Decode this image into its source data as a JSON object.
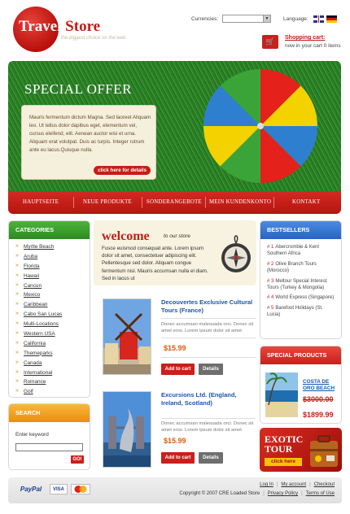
{
  "header": {
    "logo_word1": "Travel",
    "logo_word2": "Store",
    "tagline": "the biggest choice on the web",
    "currencies_label": "Currencies:",
    "language_label": "Language:",
    "cart_link": "Shopping cart:",
    "cart_items": "now in your cart 0 items"
  },
  "hero": {
    "title": "SPECIAL OFFER",
    "text": "Mauris fermentum dictum Magna. Sed laoreet Aliquam leo. Ut tellus dolor dapibus eget, elementum vel, cursus eleifend, elit. Aenean auctor wisi et urna. Aliquam erat volutpat. Duis ac turpis. Integer rutrum ante eu lacus.Quisque nulla.",
    "button": "click here for details"
  },
  "nav": [
    "HAUPTSEITE",
    "NEUE PRODUKTE",
    "SONDERANGEBOTE",
    "MEIN KUNDENKONTO",
    "KONTAKT"
  ],
  "categories": {
    "title": "CATEGORIES",
    "items": [
      "Myrtle Beach",
      "Aruba",
      "Florida",
      "Hawaii",
      "Cancun",
      "Mexico",
      "Caribbean",
      "Cabo San Lucas",
      "Multi-Locations",
      "Western USA",
      "California",
      "Themeparks",
      "Canada",
      "International",
      "Romance",
      "Golf"
    ]
  },
  "search": {
    "title": "SEARCH",
    "label": "Enter keyword",
    "go": "GO!"
  },
  "welcome": {
    "title": "welcome",
    "subtitle": "to our store",
    "text": "Fusce euismod consequat ante. Lorem ipsum dolor sit amet, consectetuer adipiscing elit. Pellentesque sed dolor. Aliquam congue fermentum nisl. Mauris accumsan nulla el diam. Sed in lacus ut"
  },
  "products": [
    {
      "title": "Decouvertes Exclusive Cultural Tours (France)",
      "desc": "Donec accumsan malesuada orci. Donec sit amet eros. Lorem ipsum dolor sit amet",
      "price": "$15.99",
      "add": "Add to cart",
      "details": "Details"
    },
    {
      "title": "Excursions Ltd. (England, Ireland, Scotland)",
      "desc": "Donec accumsan malesuada orci. Donec sit amet eros. Lorem ipsum dolor sit amet",
      "price": "$15.99",
      "add": "Add to cart",
      "details": "Details"
    }
  ],
  "bestsellers": {
    "title": "BESTSELLERS",
    "items": [
      {
        "num": "# 1",
        "text": "Abercrombie & Kent Southern Africa"
      },
      {
        "num": "# 2",
        "text": "Olive Branch Tours (Morocco)"
      },
      {
        "num": "# 3",
        "text": "Meltour Special Interest Tours (Turkey & Mongolia)"
      },
      {
        "num": "# 4",
        "text": "World Express (Singapore)"
      },
      {
        "num": "# 5",
        "text": "Barefoot Holidays (St. Lucia)"
      }
    ]
  },
  "specials": {
    "title": "SPECIAL PRODUCTS",
    "name": "COSTA DE ORO BEACH",
    "old_price": "$3000.00",
    "new_price": "$1899.99"
  },
  "exotic": {
    "title": "EXOTIC TOUR",
    "button": "click here"
  },
  "footer": {
    "paypal": "PayPal",
    "visa": "VISA",
    "mastercard": "MasterCard",
    "links": [
      "Log In",
      "My account",
      "Checkout"
    ],
    "copyright": "Copyright © 2007 CRE Loaded Store",
    "privacy": "Privacy Policy",
    "terms": "Terms of Use"
  },
  "colors": {
    "brand_red": "#c41e16",
    "link_blue": "#1a56a8",
    "grass_green": "#2a7e26",
    "orange": "#eb8d10"
  }
}
